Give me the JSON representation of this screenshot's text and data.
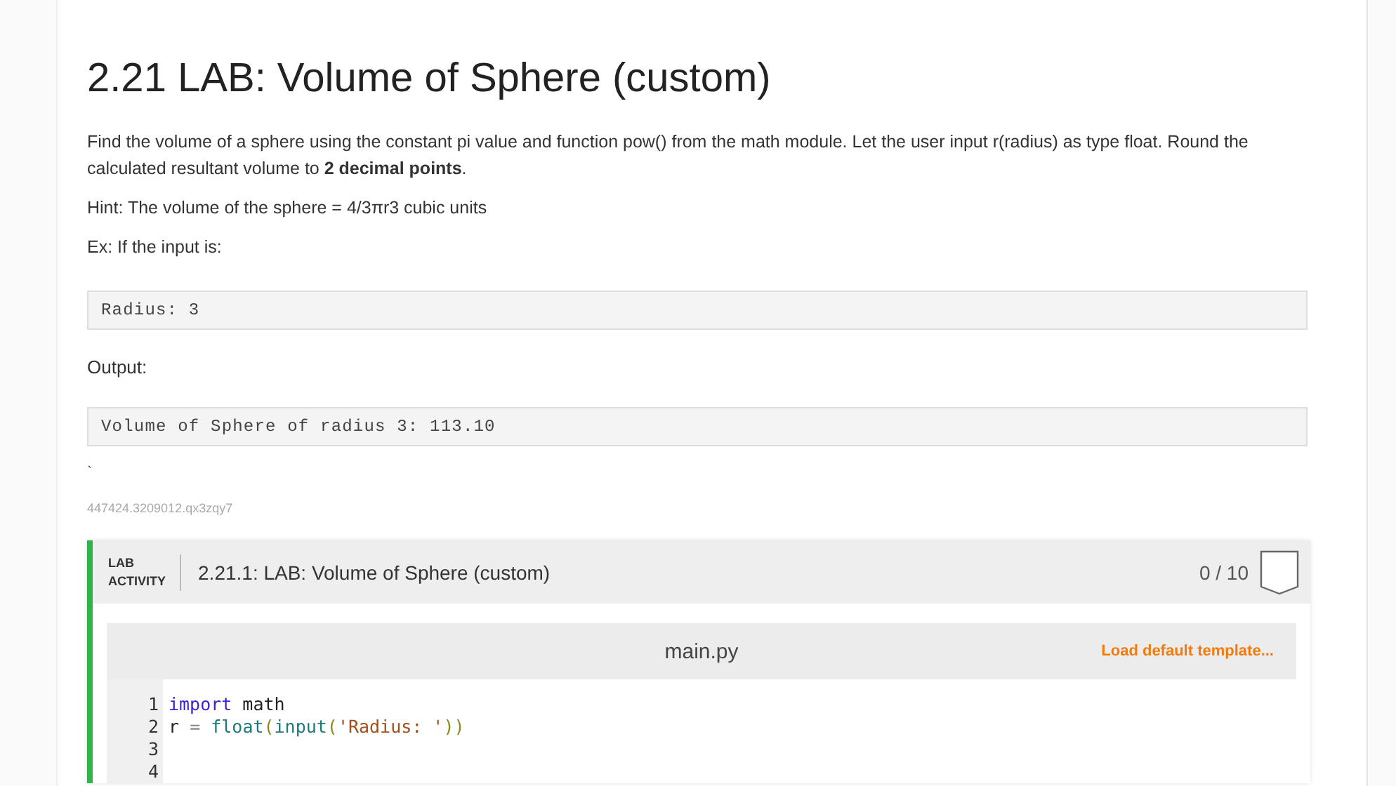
{
  "title": "2.21 LAB: Volume of Sphere (custom)",
  "paragraphs": [
    "Find the volume of a sphere using the constant pi value and function pow() from the math module. Let the user input r(radius) as type float. Round the calculated resultant volume to **2 decimal points**.",
    "Hint: The volume of the sphere = 4/3πr3 cubic units",
    "Ex: If the input is:"
  ],
  "input_example": "Radius: 3",
  "output_label": "Output:",
  "output_example": "Volume of Sphere of radius 3: 113.10",
  "stray_mark": "`",
  "content_id": "447424.3209012.qx3zqy7",
  "lab": {
    "tag_line_1": "LAB",
    "tag_line_2": "ACTIVITY",
    "title": "2.21.1: LAB: Volume of Sphere (custom)",
    "score": "0 / 10",
    "editor": {
      "filename": "main.py",
      "load_template": "Load default template...",
      "lines": [
        {
          "number": "1",
          "tokens": [
            {
              "kind": "keyword",
              "text": "import"
            },
            {
              "kind": "plain",
              "text": " math"
            }
          ]
        },
        {
          "number": "2",
          "tokens": [
            {
              "kind": "plain",
              "text": "r "
            },
            {
              "kind": "operator",
              "text": "="
            },
            {
              "kind": "builtin",
              "text": " float"
            },
            {
              "kind": "paren",
              "text": "("
            },
            {
              "kind": "builtin",
              "text": "input"
            },
            {
              "kind": "paren",
              "text": "("
            },
            {
              "kind": "string",
              "text": "'Radius: '"
            },
            {
              "kind": "paren",
              "text": "))"
            }
          ]
        },
        {
          "number": "3"
        },
        {
          "number": "4"
        }
      ]
    }
  }
}
